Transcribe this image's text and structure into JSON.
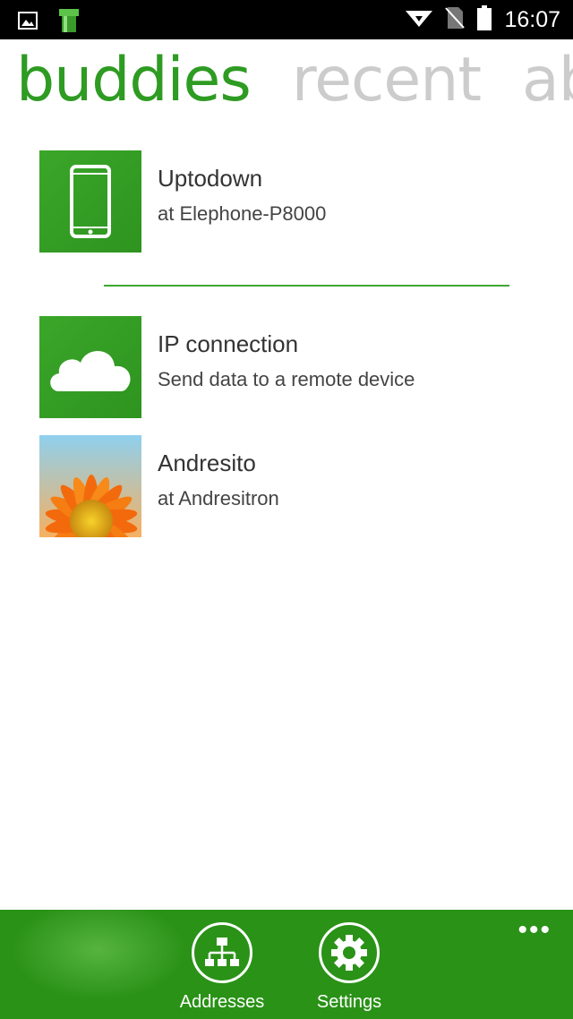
{
  "status_bar": {
    "time": "16:07"
  },
  "pivot": {
    "tabs": [
      {
        "label": "buddies",
        "active": true
      },
      {
        "label": "recent",
        "active": false
      },
      {
        "label": "ab",
        "active": false
      }
    ]
  },
  "list": {
    "items": [
      {
        "name": "Uptodown",
        "subtitle": "at Elephone-P8000",
        "icon": "phone-icon"
      },
      {
        "name": "IP connection",
        "subtitle": "Send data to a remote device",
        "icon": "cloud-icon"
      },
      {
        "name": "Andresito",
        "subtitle": "at Andresitron",
        "icon": "flower-thumbnail"
      }
    ]
  },
  "app_bar": {
    "buttons": [
      {
        "label": "Addresses",
        "icon": "network-icon"
      },
      {
        "label": "Settings",
        "icon": "gear-icon"
      }
    ],
    "more": "•••"
  },
  "colors": {
    "accent": "#2e9b22",
    "app_bar": "#2a9217",
    "inactive_tab": "#cccccc"
  }
}
